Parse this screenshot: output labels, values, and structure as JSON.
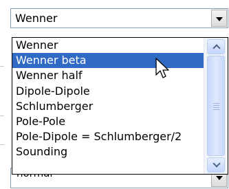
{
  "combo": {
    "selected_value": "Wenner"
  },
  "dropdown": {
    "items": [
      {
        "label": "Wenner"
      },
      {
        "label": "Wenner beta"
      },
      {
        "label": "Wenner half"
      },
      {
        "label": "Dipole-Dipole"
      },
      {
        "label": "Schlumberger"
      },
      {
        "label": "Pole-Pole"
      },
      {
        "label": "Pole-Dipole = Schlumberger/2"
      },
      {
        "label": "Sounding"
      }
    ],
    "highlighted_item": "Wenner beta",
    "highlight_color": "#316ac5"
  },
  "below_combo": {
    "value": "normal"
  },
  "icons": {
    "combo_arrow": "chevron-down-icon",
    "scroll_up": "chevron-up-icon",
    "scroll_down": "chevron-down-icon",
    "cursor": "mouse-pointer-icon"
  }
}
